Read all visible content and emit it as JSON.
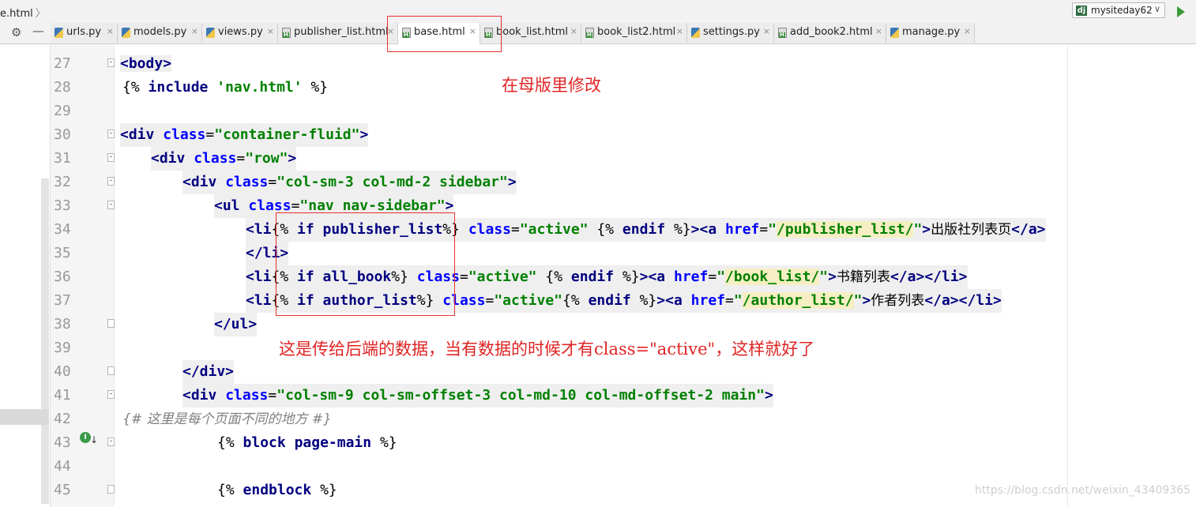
{
  "breadcrumb": {
    "file": "e.html",
    "arrow": "〉"
  },
  "run_config": {
    "icon": "dj",
    "name": "mysiteday62",
    "chevron": "∨"
  },
  "toolbar": {
    "settings_icon": "⚙",
    "hide_icon": "—"
  },
  "tabs": [
    {
      "label": "urls.py",
      "type": "py",
      "close": "×"
    },
    {
      "label": "models.py",
      "type": "py",
      "close": "×"
    },
    {
      "label": "views.py",
      "type": "py",
      "close": "×"
    },
    {
      "label": "publisher_list.html",
      "type": "html",
      "close": "×"
    },
    {
      "label": "base.html",
      "type": "html",
      "close": "×",
      "active": true
    },
    {
      "label": "book_list.html",
      "type": "html",
      "close": "×"
    },
    {
      "label": "book_list2.html",
      "type": "html",
      "close": "×"
    },
    {
      "label": "settings.py",
      "type": "py",
      "close": "×"
    },
    {
      "label": "add_book2.html",
      "type": "html",
      "close": "×"
    },
    {
      "label": "manage.py",
      "type": "py",
      "close": "×"
    }
  ],
  "line_numbers": [
    "27",
    "28",
    "29",
    "30",
    "31",
    "32",
    "33",
    "34",
    "35",
    "36",
    "37",
    "38",
    "39",
    "40",
    "41",
    "42",
    "43",
    "44",
    "45"
  ],
  "code": {
    "l27": {
      "lt": "<",
      "name": "body",
      "gt": ">"
    },
    "l28": {
      "open": "{%",
      "kw": "include",
      "str": "'nav.html'",
      "close": "%}"
    },
    "l30": {
      "lt": "<",
      "name": "div",
      "attr": "class",
      "eq": "=",
      "val": "\"container-fluid\"",
      "gt": ">"
    },
    "l31": {
      "lt": "<",
      "name": "div",
      "attr": "class",
      "eq": "=",
      "val": "\"row\"",
      "gt": ">"
    },
    "l32": {
      "lt": "<",
      "name": "div",
      "attr": "class",
      "eq": "=",
      "val": "\"col-sm-3 col-md-2 sidebar\"",
      "gt": ">"
    },
    "l33": {
      "lt": "<",
      "name": "ul",
      "attr": "class",
      "eq": "=",
      "val": "\"nav nav-sidebar\"",
      "gt": ">"
    },
    "l34": {
      "li": "<li",
      "open": "{%",
      "cond": "if publisher_list",
      "close": "%}",
      "attr": "class",
      "eq": "=",
      "val": "\"active\"",
      "endopen": "{%",
      "endkw": "endif",
      "endclose": "%}",
      "gt1": ">",
      "a_open": "<a",
      "href": "href",
      "heq": "=",
      "q1": "\"",
      "url": "/publisher_list/",
      "q2": "\"",
      "gt2": ">",
      "text": "出版社列表页",
      "a_close": "</a>"
    },
    "l35": {
      "close_li": "</li>"
    },
    "l36": {
      "li": "<li",
      "open": "{%",
      "cond": "if all_book",
      "close": "%}",
      "attr": "class",
      "eq": "=",
      "val": "\"active\"",
      "endopen": "{%",
      "endkw": "endif",
      "endclose": "%}",
      "gt1": ">",
      "a_open": "<a",
      "href": "href",
      "heq": "=",
      "q1": "\"",
      "url": "/book_list/",
      "q2": "\"",
      "gt2": ">",
      "text": "书籍列表",
      "a_close": "</a>",
      "li_close": "</li>"
    },
    "l37": {
      "li": "<li",
      "open": "{%",
      "cond": "if author_list",
      "close": "%}",
      "attr": "class",
      "eq": "=",
      "val": "\"active\"",
      "endopen": "{%",
      "endkw": "endif",
      "endclose": "%}",
      "gt1": ">",
      "a_open": "<a",
      "href": "href",
      "heq": "=",
      "q1": "\"",
      "url": "/author_list/",
      "q2": "\"",
      "gt2": ">",
      "text": "作者列表",
      "a_close": "</a>",
      "li_close": "</li>"
    },
    "l38": {
      "close": "</ul>"
    },
    "l40": {
      "close": "</div>"
    },
    "l41": {
      "lt": "<",
      "name": "div",
      "attr": "class",
      "eq": "=",
      "val": "\"col-sm-9 col-sm-offset-3 col-md-10 col-md-offset-2 main\"",
      "gt": ">"
    },
    "l42": {
      "comment": "{# 这里是每个页面不同的地方 #}"
    },
    "l43": {
      "open": "{%",
      "kw": "block",
      "name": "page-main",
      "close": "%}"
    },
    "l45": {
      "open": "{%",
      "kw": "endblock",
      "close": "%}"
    }
  },
  "annotations": {
    "top": "在母版里修改",
    "bottom": "这是传给后端的数据，当有数据的时候才有class=\"active\"，这样就好了"
  },
  "gutter_icons": {
    "implemented": "I",
    "arrow": "↓"
  },
  "watermark": "https://blog.csdn.net/weixin_43409365",
  "colors": {
    "annotation": "#e02424",
    "tag": "#000080",
    "attribute": "#0000ff",
    "string": "#008000",
    "comment": "#808080"
  }
}
